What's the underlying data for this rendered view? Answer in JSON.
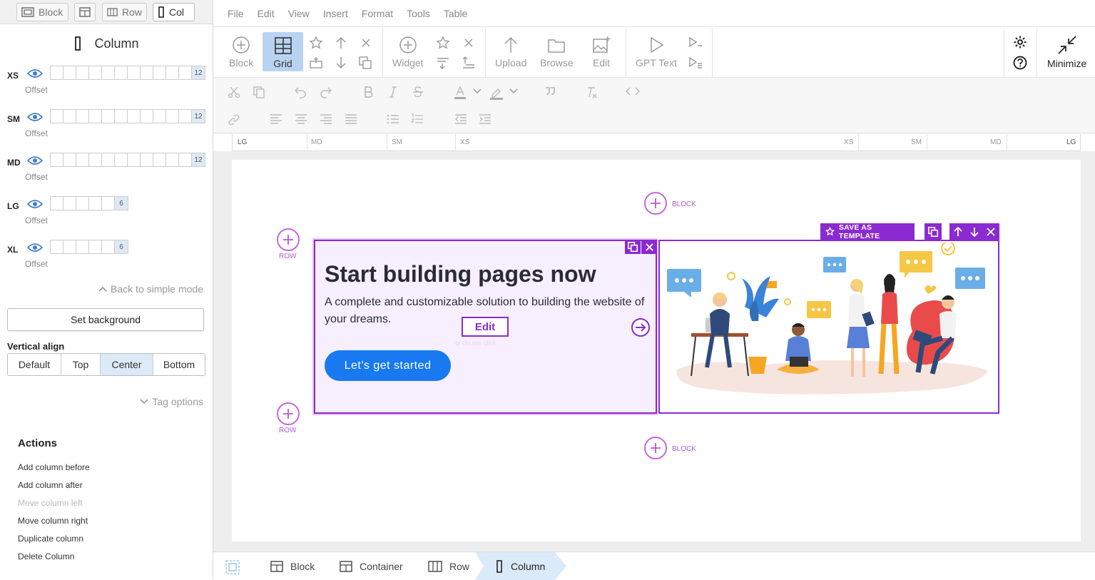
{
  "mode_tabs": {
    "block": "Block",
    "row": "Row",
    "col": "Col"
  },
  "panel": {
    "title": "Column",
    "breakpoints": [
      {
        "name": "XS",
        "span": 12,
        "cells": 12,
        "offset_label": "Offset"
      },
      {
        "name": "SM",
        "span": 12,
        "cells": 12,
        "offset_label": "Offset"
      },
      {
        "name": "MD",
        "span": 12,
        "cells": 12,
        "offset_label": "Offset"
      },
      {
        "name": "LG",
        "span": 6,
        "cells": 6,
        "offset_label": "Offset"
      },
      {
        "name": "XL",
        "span": 6,
        "cells": 6,
        "offset_label": "Offset"
      }
    ],
    "back_to_simple": "Back to simple mode",
    "set_background": "Set background",
    "vertical_align_label": "Vertical align",
    "vertical_align": {
      "options": [
        "Default",
        "Top",
        "Center",
        "Bottom"
      ],
      "selected": "Center"
    },
    "tag_options": "Tag options",
    "actions_title": "Actions",
    "actions": [
      {
        "label": "Add column before",
        "enabled": true
      },
      {
        "label": "Add column after",
        "enabled": true
      },
      {
        "label": "Move column left",
        "enabled": false
      },
      {
        "label": "Move column right",
        "enabled": true
      },
      {
        "label": "Duplicate column",
        "enabled": true
      },
      {
        "label": "Delete Column",
        "enabled": true
      }
    ]
  },
  "menu": [
    "File",
    "Edit",
    "View",
    "Insert",
    "Format",
    "Tools",
    "Table"
  ],
  "toolbar": {
    "block": "Block",
    "grid": "Grid",
    "widget": "Widget",
    "upload": "Upload",
    "browse": "Browse",
    "edit": "Edit",
    "gpt_text": "GPT Text",
    "minimize": "Minimize"
  },
  "ruler": {
    "left": [
      "LG",
      "MD",
      "SM",
      "XS"
    ],
    "right": [
      "XS",
      "SM",
      "MD",
      "LG"
    ]
  },
  "canvas": {
    "block_label": "BLOCK",
    "row_label": "ROW",
    "save_as_template": "SAVE AS TEMPLATE",
    "edit_button": "Edit",
    "edit_hint": "or double click",
    "hero": {
      "title": "Start building pages now",
      "subtitle": "A complete and customizable solution to building the website of your dreams.",
      "cta": "Let's get started"
    }
  },
  "breadcrumbs": [
    "Block",
    "Container",
    "Row",
    "Column"
  ],
  "colors": {
    "accent": "#8a2bd1",
    "handle": "#c26ad8",
    "cta": "#1879f0",
    "selected": "#dce9f7"
  }
}
